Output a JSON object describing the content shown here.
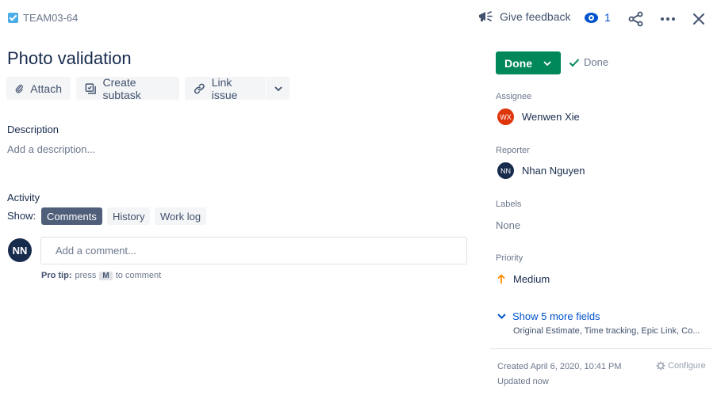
{
  "header": {
    "issue_key": "TEAM03-64",
    "give_feedback": "Give feedback",
    "watch_count": "1"
  },
  "issue": {
    "title": "Photo validation"
  },
  "toolbar": {
    "attach": "Attach",
    "create_subtask": "Create subtask",
    "link_issue": "Link issue"
  },
  "description": {
    "label": "Description",
    "placeholder": "Add a description..."
  },
  "activity": {
    "label": "Activity",
    "show_label": "Show:",
    "tabs": [
      {
        "label": "Comments",
        "active": true
      },
      {
        "label": "History",
        "active": false
      },
      {
        "label": "Work log",
        "active": false
      }
    ],
    "user_initials": "NN",
    "comment_placeholder": "Add a comment...",
    "pro_tip_bold": "Pro tip:",
    "pro_tip_pre": "press",
    "pro_tip_key": "M",
    "pro_tip_post": "to comment"
  },
  "sidebar": {
    "status": "Done",
    "resolution": "Done",
    "assignee": {
      "label": "Assignee",
      "name": "Wenwen Xie",
      "initials": "WX",
      "color": "#de350b"
    },
    "reporter": {
      "label": "Reporter",
      "name": "Nhan Nguyen",
      "initials": "NN",
      "color": "#172b4d"
    },
    "labels": {
      "label": "Labels",
      "value": "None"
    },
    "priority": {
      "label": "Priority",
      "value": "Medium",
      "color": "#ff8b00"
    },
    "more_fields": "Show 5 more fields",
    "more_fields_list": "Original Estimate, Time tracking, Epic Link, Co...",
    "created": "Created April 6, 2020, 10:41 PM",
    "updated": "Updated now",
    "configure": "Configure"
  },
  "colors": {
    "accent": "#0052cc",
    "done_green": "#00875a",
    "text": "#172b4d",
    "subtle": "#6b778c"
  }
}
